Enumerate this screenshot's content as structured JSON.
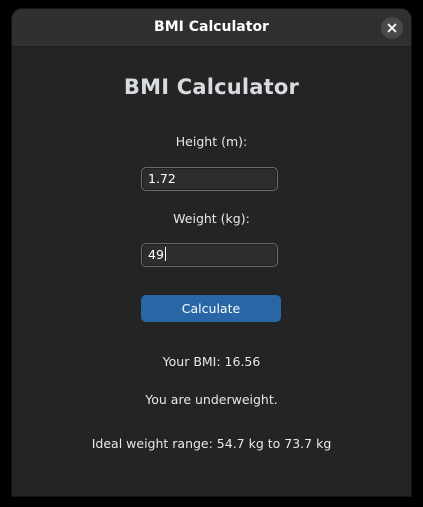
{
  "window": {
    "title": "BMI Calculator",
    "close_icon": "close-icon"
  },
  "app": {
    "heading": "BMI Calculator",
    "height_label": "Height (m):",
    "height_value": "1.72",
    "weight_label": "Weight (kg):",
    "weight_value": "49",
    "calculate_label": "Calculate",
    "bmi_result": "Your BMI: 16.56",
    "category_result": "You are underweight.",
    "ideal_range": "Ideal weight range: 54.7 kg to 73.7 kg"
  },
  "colors": {
    "window_bg": "#242424",
    "titlebar_bg": "#303030",
    "accent": "#2866a6",
    "field_bg": "#2d2d2d",
    "text": "#e8e8e8"
  }
}
